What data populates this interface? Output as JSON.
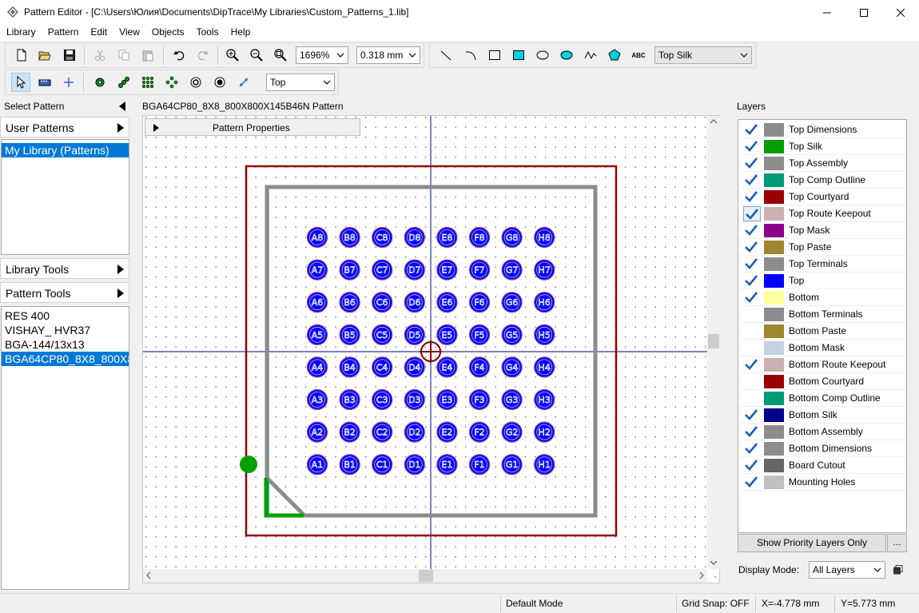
{
  "window": {
    "title": "Pattern Editor - [C:\\Users\\Юлия\\Documents\\DipTrace\\My Libraries\\Custom_Patterns_1.lib]"
  },
  "menu": [
    "Library",
    "Pattern",
    "Edit",
    "View",
    "Objects",
    "Tools",
    "Help"
  ],
  "toolbar": {
    "zoom_value": "1696%",
    "grid_value": "0.318 mm",
    "layer_select": "Top Silk",
    "side_select": "Top",
    "text_tool_label": "ABC"
  },
  "left_panel": {
    "select_pattern_title": "Select Pattern",
    "user_patterns": "User Patterns",
    "libraries": [
      "My Library (Patterns)"
    ],
    "library_tools": "Library Tools",
    "pattern_tools": "Pattern Tools",
    "patterns": [
      "RES 400",
      "VISHAY_ HVR37",
      "BGA-144/13x13",
      "BGA64CP80_8X8_800X8"
    ]
  },
  "editor": {
    "pattern_title": "BGA64CP80_8X8_800X800X145B46N Pattern",
    "properties_label": "Pattern Properties",
    "pad_columns": [
      "A",
      "B",
      "C",
      "D",
      "E",
      "F",
      "G",
      "H"
    ],
    "pad_rows": [
      8,
      7,
      6,
      5,
      4,
      3,
      2,
      1
    ]
  },
  "layers_panel": {
    "title": "Layers",
    "layers": [
      {
        "name": "Top Dimensions",
        "color": "#8c8c8c",
        "checked": true
      },
      {
        "name": "Top Silk",
        "color": "#00a000",
        "checked": true
      },
      {
        "name": "Top Assembly",
        "color": "#8c8c8c",
        "checked": true
      },
      {
        "name": "Top Comp Outline",
        "color": "#009a74",
        "checked": true
      },
      {
        "name": "Top Courtyard",
        "color": "#9a0000",
        "checked": true
      },
      {
        "name": "Top Route Keepout",
        "color": "#c9b1b1",
        "checked": true,
        "focused": true
      },
      {
        "name": "Top Mask",
        "color": "#8b008b",
        "checked": true
      },
      {
        "name": "Top Paste",
        "color": "#a08530",
        "checked": true
      },
      {
        "name": "Top Terminals",
        "color": "#8c8c8c",
        "checked": true
      },
      {
        "name": "Top",
        "color": "#0000ff",
        "checked": true
      },
      {
        "name": "Bottom",
        "color": "#ffffa0",
        "checked": true
      },
      {
        "name": "Bottom Terminals",
        "color": "#8c8c8c",
        "checked": false
      },
      {
        "name": "Bottom Paste",
        "color": "#a08530",
        "checked": false
      },
      {
        "name": "Bottom Mask",
        "color": "#c3d2e0",
        "checked": false
      },
      {
        "name": "Bottom Route Keepout",
        "color": "#c9b1b1",
        "checked": true
      },
      {
        "name": "Bottom Courtyard",
        "color": "#9a0000",
        "checked": false
      },
      {
        "name": "Bottom Comp Outline",
        "color": "#009a74",
        "checked": false
      },
      {
        "name": "Bottom Silk",
        "color": "#00008b",
        "checked": true
      },
      {
        "name": "Bottom Assembly",
        "color": "#8c8c8c",
        "checked": true
      },
      {
        "name": "Bottom Dimensions",
        "color": "#8c8c8c",
        "checked": true
      },
      {
        "name": "Board Cutout",
        "color": "#666666",
        "checked": true
      },
      {
        "name": "Mounting Holes",
        "color": "#c0c0c0",
        "checked": true
      }
    ],
    "priority_button": "Show Priority Layers Only",
    "more_button": "...",
    "display_mode_label": "Display Mode:",
    "display_mode_value": "All Layers"
  },
  "status": {
    "mode": "Default Mode",
    "grid_snap": "Grid Snap: OFF",
    "x": "X=-4.778 mm",
    "y": "Y=5.773 mm"
  },
  "colors": {
    "accent": "#0078d7",
    "courtyard": "#9a0000",
    "assembly": "#8c8c8c",
    "silk": "#00a000",
    "pad": "#0000ff",
    "crosshair": "#000080"
  }
}
